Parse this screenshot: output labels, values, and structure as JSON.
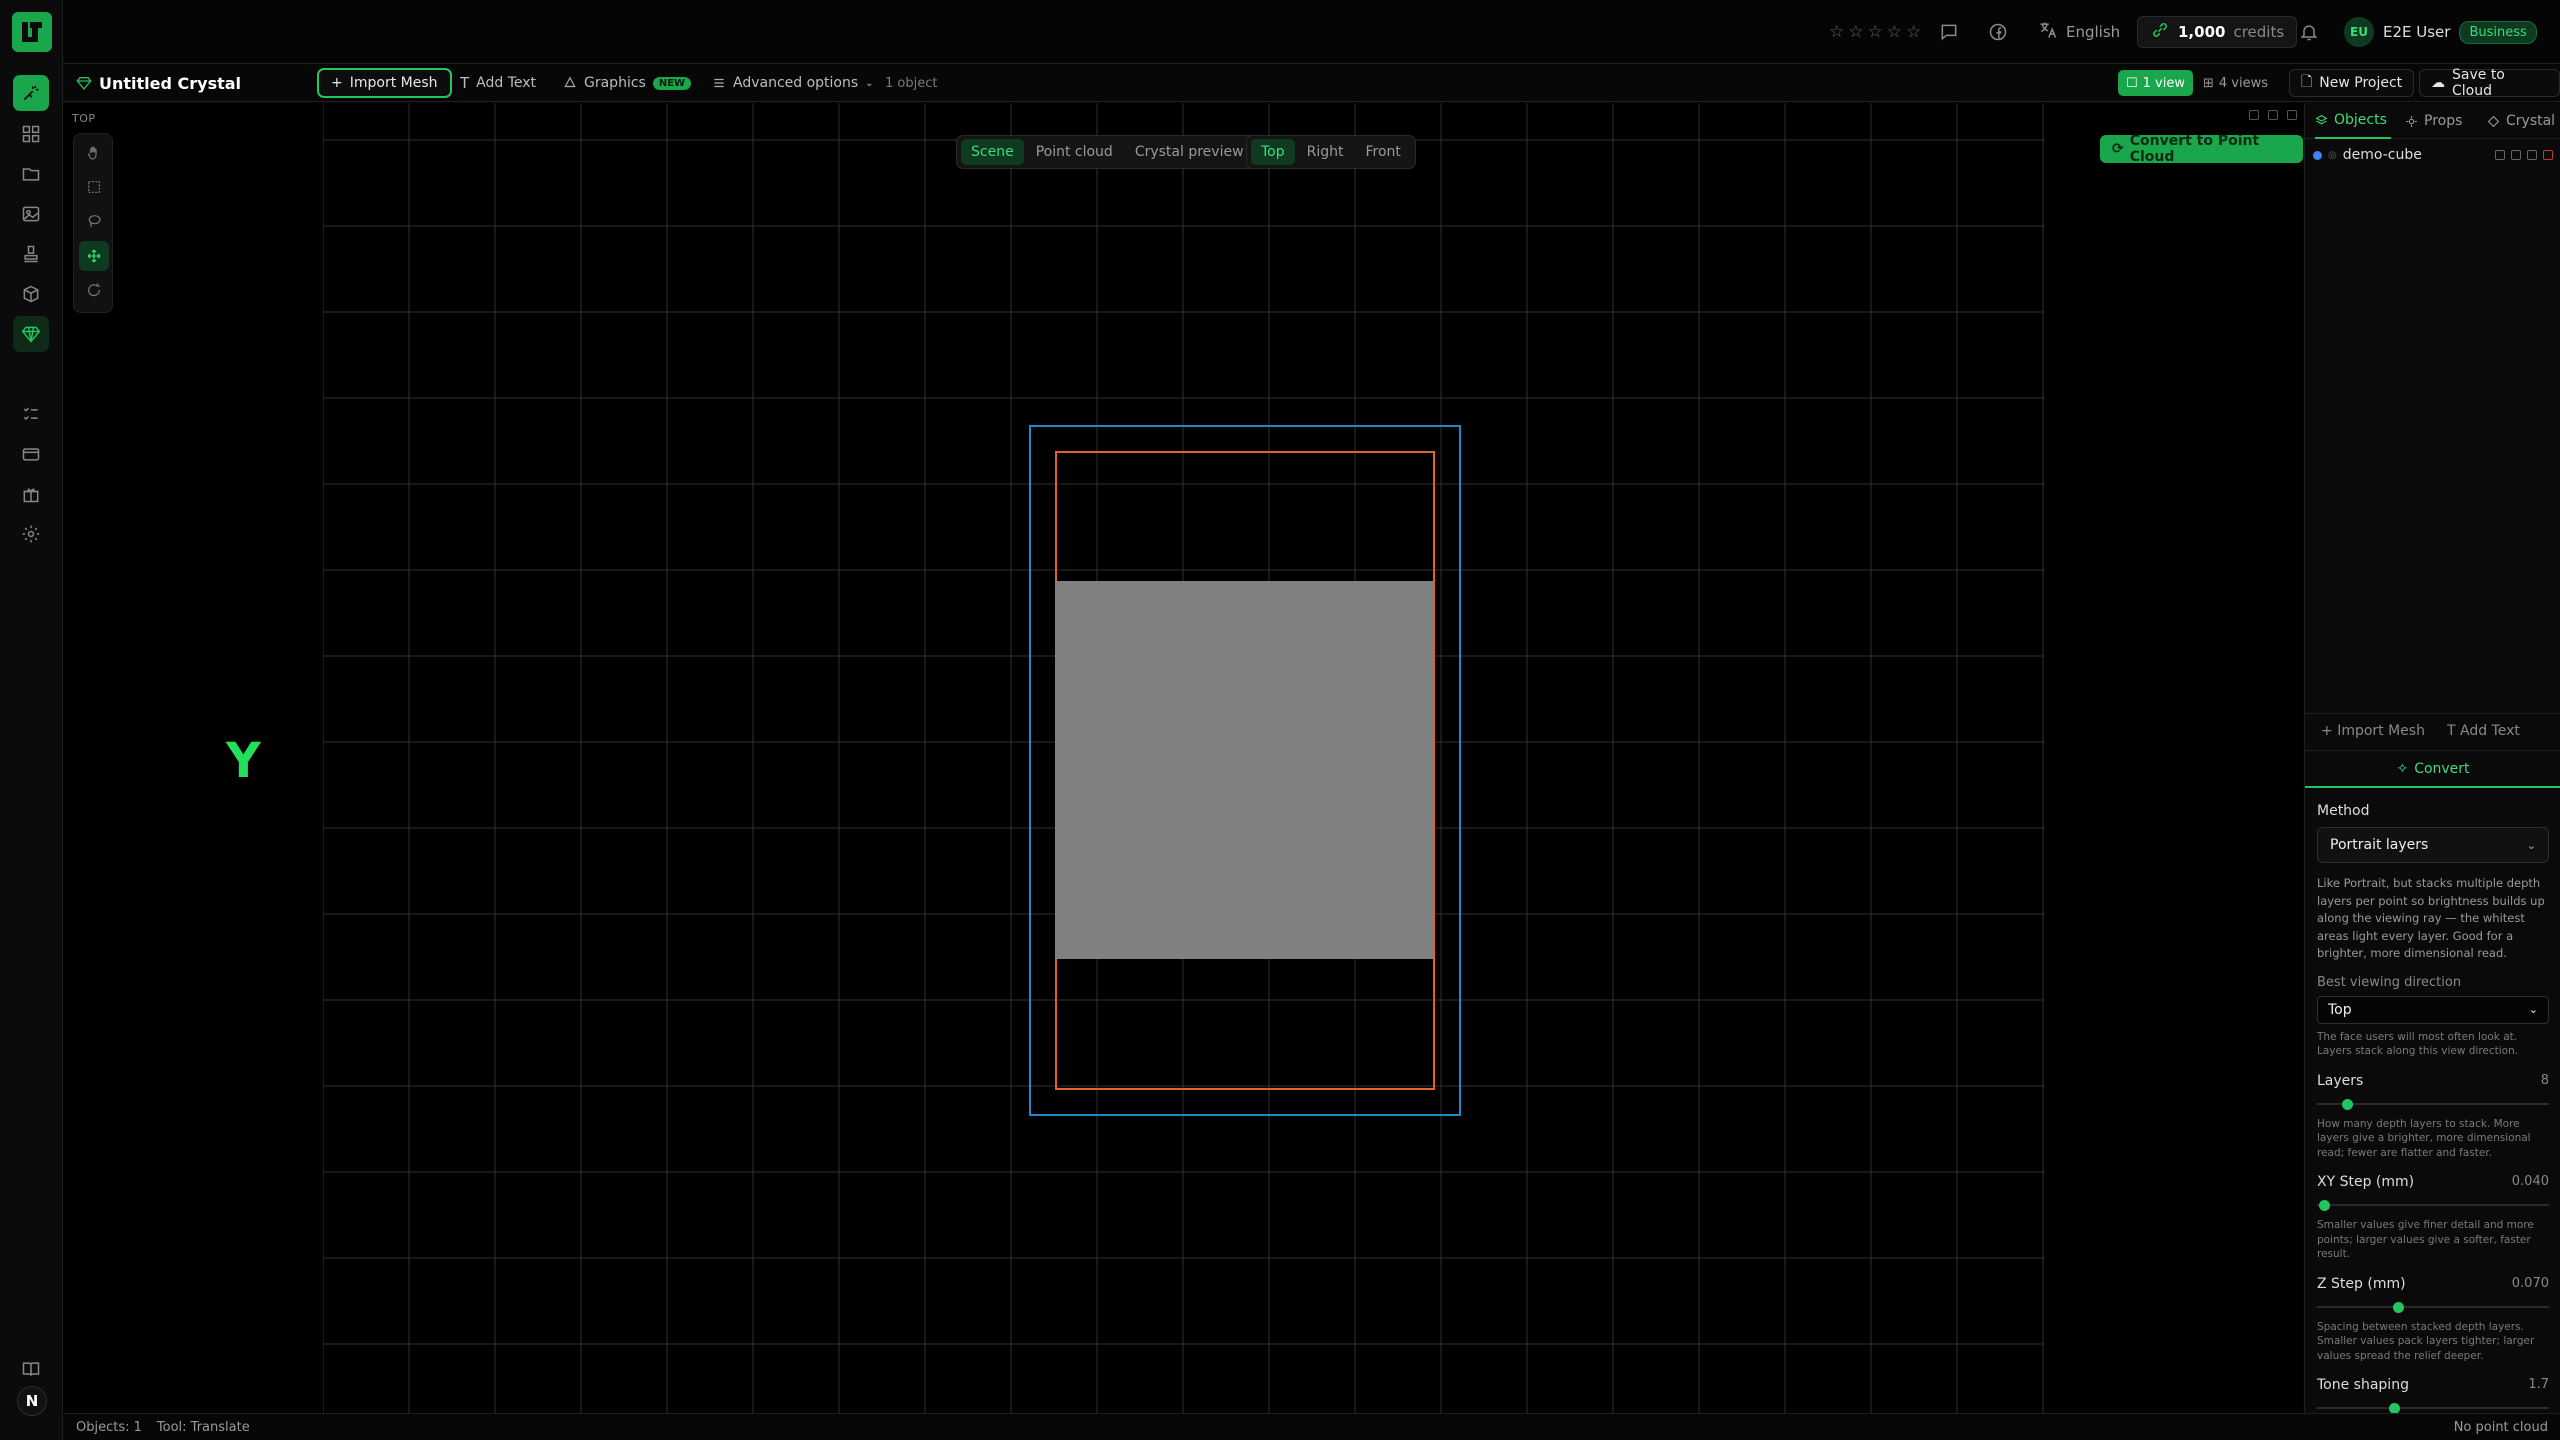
{
  "topbar": {
    "stars": [
      "☆",
      "☆",
      "☆",
      "☆",
      "☆"
    ],
    "language": "English",
    "credits": "1,000",
    "credits_label": "credits",
    "user_initials": "EU",
    "user_name": "E2E User",
    "plan": "Business"
  },
  "toolbar": {
    "project_title": "Untitled Crystal",
    "import_mesh": "Import Mesh",
    "add_text": "Add Text",
    "graphics": "Graphics",
    "graphics_badge": "NEW",
    "advanced": "Advanced options",
    "object_count": "1 object",
    "views": {
      "one": "1 view",
      "four": "4 views"
    },
    "new_project": "New Project",
    "save_cloud": "Save to Cloud"
  },
  "viewport": {
    "view_label": "TOP",
    "axis_label": "Y",
    "modes": [
      "Scene",
      "Point cloud",
      "Crystal preview"
    ],
    "active_mode": "Scene",
    "views": [
      "Top",
      "Right",
      "Front"
    ],
    "active_view": "Top",
    "convert_button": "Convert to Point Cloud"
  },
  "panel": {
    "tabs": [
      "Objects",
      "Props",
      "Crystal"
    ],
    "active_tab": "Objects",
    "objects": [
      {
        "name": "demo-cube"
      }
    ],
    "actions": {
      "import": "Import Mesh",
      "text": "Add Text"
    },
    "convert_tab": "Convert",
    "method_label": "Method",
    "method_value": "Portrait layers",
    "method_desc": "Like Portrait, but stacks multiple depth layers per point so brightness builds up along the viewing ray — the whitest areas light every layer. Good for a brighter, more dimensional read.",
    "direction_label": "Best viewing direction",
    "direction_value": "Top",
    "direction_note": "The face users will most often look at. Layers stack along this view direction.",
    "layers_label": "Layers",
    "layers_value": "8",
    "layers_fraction": 0.13,
    "layers_help": "How many depth layers to stack. More layers give a brighter, more dimensional read; fewer are flatter and faster.",
    "xy_label": "XY Step (mm)",
    "xy_value": "0.040",
    "xy_fraction": 0.03,
    "xy_help": "Smaller values give finer detail and more points; larger values give a softer, faster result.",
    "z_label": "Z Step (mm)",
    "z_value": "0.070",
    "z_fraction": 0.35,
    "z_help": "Spacing between stacked depth layers. Smaller values pack layers tighter; larger values spread the relief deeper.",
    "tone_label": "Tone shaping",
    "tone_value": "1.7",
    "tone_fraction": 0.33
  },
  "status": {
    "objects": "Objects: 1",
    "tool": "Tool: Translate",
    "point_cloud": "No point cloud"
  },
  "colors": {
    "accent": "#22c55e",
    "bbox_outer": "#1e88c8",
    "bbox_inner": "#e0632a",
    "mesh": "#808080"
  }
}
